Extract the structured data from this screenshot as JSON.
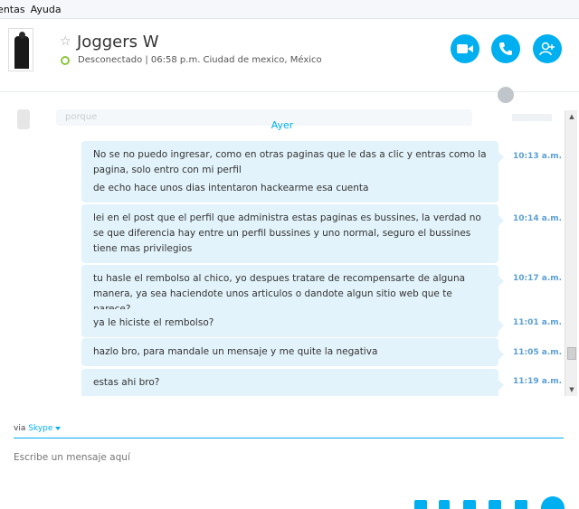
{
  "menubar": {
    "items": [
      "ientas",
      "Ayuda"
    ]
  },
  "contact": {
    "name": "Joggers W",
    "status": "Desconectado",
    "details": "| 06:58 p.m. Ciudad de mexico, México"
  },
  "header_actions": [
    {
      "name": "video-call-button",
      "icon": "video-camera-icon"
    },
    {
      "name": "call-button",
      "icon": "phone-icon"
    },
    {
      "name": "add-contact-button",
      "icon": "add-person-icon"
    }
  ],
  "chat": {
    "prior_message_partial": "porque",
    "date_separator": "Ayer",
    "messages": [
      {
        "lines": [
          "No se no puedo ingresar, como en otras paginas que le das a clic y entras como la pagina, solo entro con mi perfil",
          "de echo hace unos dias intentaron hackearme esa cuenta"
        ],
        "time": "10:13 a.m."
      },
      {
        "lines": [
          "lei en el post que el perfil que administra estas paginas es bussines, la verdad no se que diferencia hay entre un perfil bussines y uno normal, seguro el bussines tiene mas privilegios"
        ],
        "time": "10:14 a.m."
      },
      {
        "lines": [
          "tu hasle el rembolso al chico, yo despues tratare de recompensarte de alguna manera, ya sea haciendote unos articulos o dandote algun sitio web que te parece?"
        ],
        "time": "10:17 a.m."
      },
      {
        "lines": [
          "ya le hiciste el rembolso?"
        ],
        "time": "11:01 a.m."
      },
      {
        "lines": [
          "hazlo bro, para mandale un mensaje y me quite la negativa"
        ],
        "time": "11:05 a.m."
      },
      {
        "lines": [
          "estas ahi bro?"
        ],
        "time": "11:19 a.m."
      }
    ]
  },
  "compose": {
    "via_label": "via",
    "via_service": "Skype",
    "placeholder": "Escribe un mensaje aquí"
  },
  "colors": {
    "accent": "#00aff0",
    "bubble": "#e3f3fb",
    "online_ring": "#8dc63f"
  }
}
